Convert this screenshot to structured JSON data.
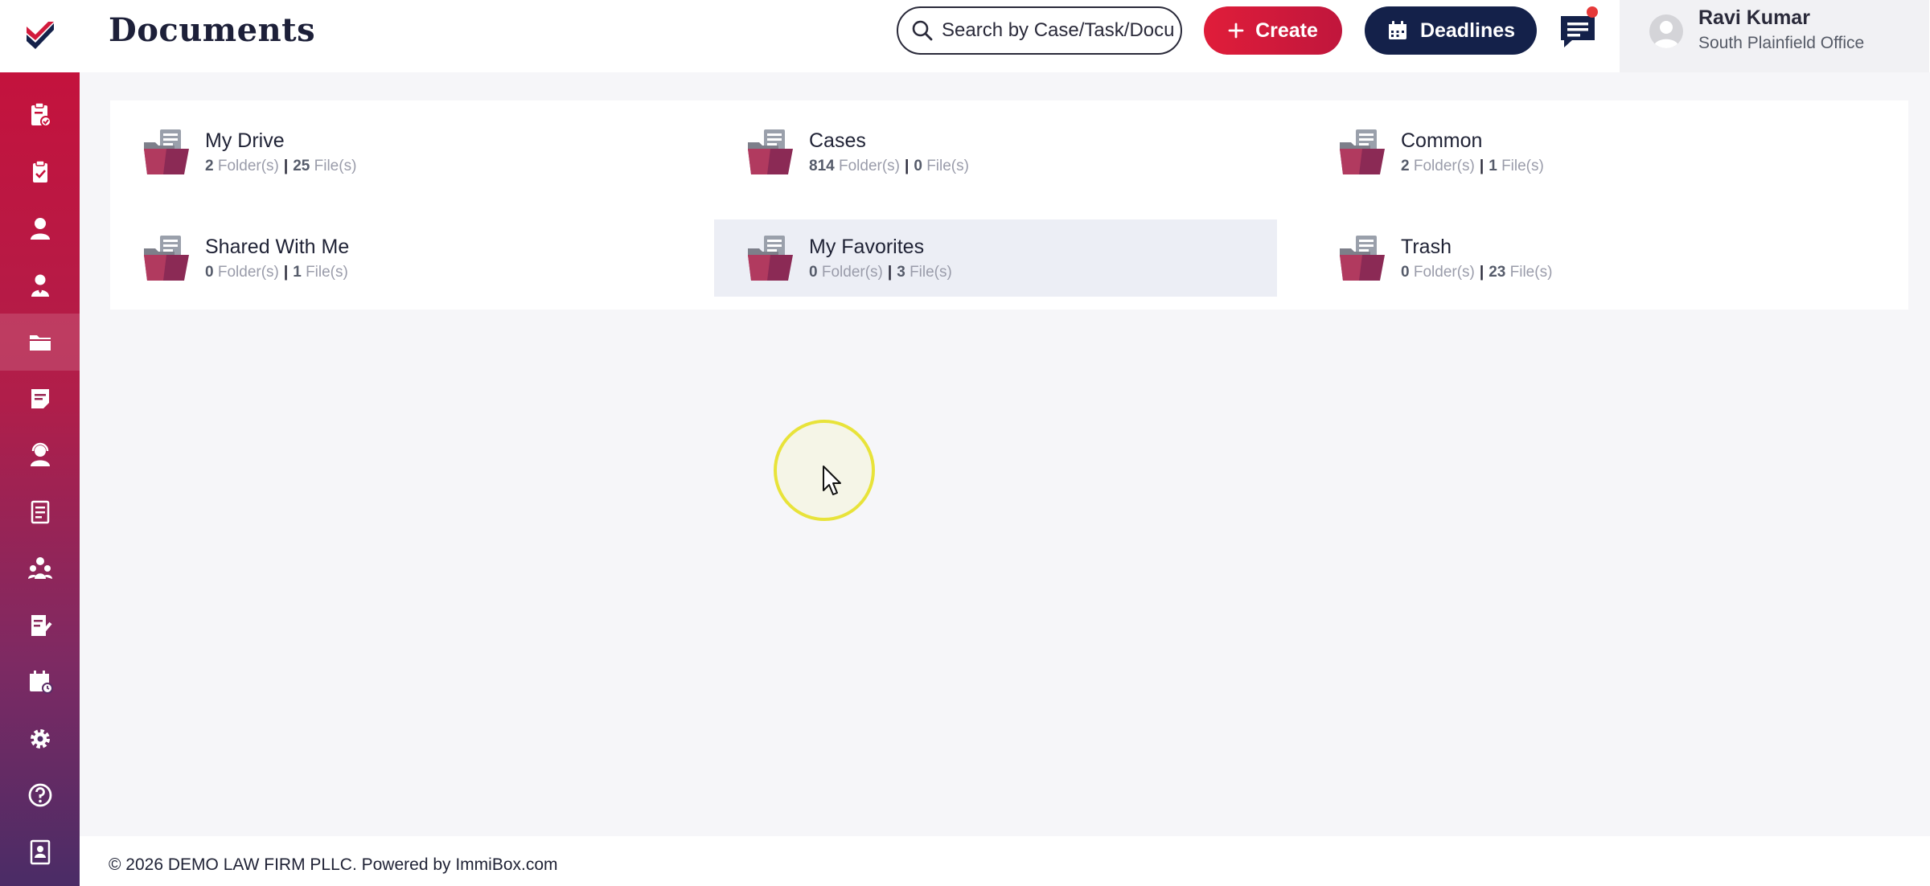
{
  "header": {
    "title": "Documents",
    "search": {
      "placeholder": "Search by Case/Task/Document",
      "value": ""
    },
    "create_label": "Create",
    "deadlines_label": "Deadlines",
    "user": {
      "name": "Ravi Kumar",
      "office": "South Plainfield Office"
    }
  },
  "sidebar": {
    "items": [
      {
        "icon": "edit-note-icon"
      },
      {
        "icon": "case-clipboard-icon"
      },
      {
        "icon": "task-clipboard-icon"
      },
      {
        "icon": "client-user-icon"
      },
      {
        "icon": "contact-user-icon"
      },
      {
        "icon": "documents-folder-icon",
        "active": true
      },
      {
        "icon": "notes-icon"
      },
      {
        "icon": "support-agent-icon"
      },
      {
        "icon": "ledger-book-icon"
      },
      {
        "icon": "team-users-icon"
      },
      {
        "icon": "form-edit-icon"
      },
      {
        "icon": "calendar-icon"
      },
      {
        "icon": "settings-gear-icon"
      },
      {
        "icon": "help-icon"
      },
      {
        "icon": "address-book-icon"
      }
    ]
  },
  "folders": [
    {
      "name": "My Drive",
      "folders": "2",
      "files": "25",
      "folder_label": "Folder(s)",
      "file_label": "File(s)"
    },
    {
      "name": "Cases",
      "folders": "814",
      "files": "0",
      "folder_label": "Folder(s)",
      "file_label": "File(s)"
    },
    {
      "name": "Common",
      "folders": "2",
      "files": "1",
      "folder_label": "Folder(s)",
      "file_label": "File(s)"
    },
    {
      "name": "Shared With Me",
      "folders": "0",
      "files": "1",
      "folder_label": "Folder(s)",
      "file_label": "File(s)"
    },
    {
      "name": "My Favorites",
      "folders": "0",
      "files": "3",
      "folder_label": "Folder(s)",
      "file_label": "File(s)",
      "highlighted": true
    },
    {
      "name": "Trash",
      "folders": "0",
      "files": "23",
      "folder_label": "Folder(s)",
      "file_label": "File(s)"
    }
  ],
  "footer": {
    "text": "© 2026 DEMO LAW FIRM PLLC. Powered by ImmiBox.com"
  },
  "colors": {
    "brand_red": "#d21a3c",
    "navy": "#14214a",
    "sidebar_bottom": "#4a2c66"
  }
}
